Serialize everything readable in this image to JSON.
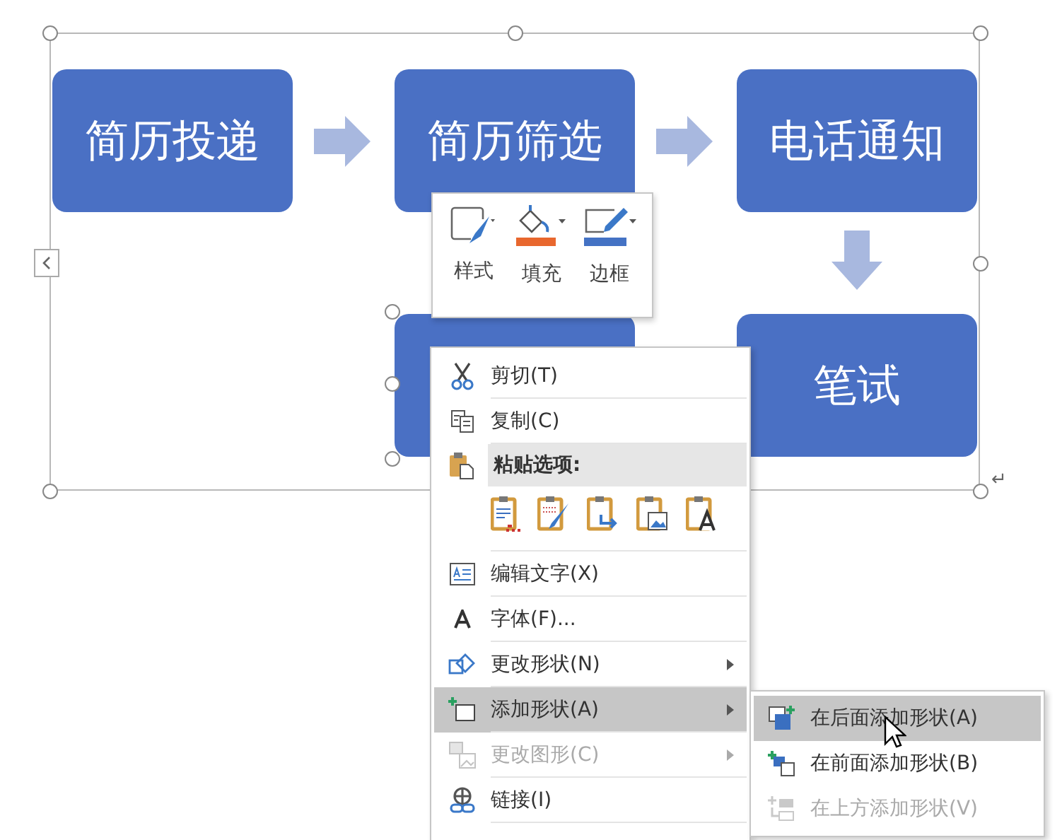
{
  "diagram": {
    "shapes": [
      {
        "text": "简历投递",
        "selected": false
      },
      {
        "text": "简历筛选",
        "selected": false
      },
      {
        "text": "电话通知",
        "selected": false
      },
      {
        "selected": true
      },
      {
        "text": "笔试",
        "selected": false
      }
    ],
    "paragraph_mark": "↵"
  },
  "mini_toolbar": {
    "buttons": [
      {
        "label": "样式"
      },
      {
        "label": "填充"
      },
      {
        "label": "边框"
      }
    ]
  },
  "context_menu": {
    "items": [
      {
        "kind": "command",
        "label": "剪切(T)",
        "disabled": false,
        "selected": false,
        "submenu": false
      },
      {
        "kind": "command",
        "label": "复制(C)",
        "disabled": false,
        "selected": false,
        "submenu": false
      },
      {
        "kind": "header",
        "label": "粘贴选项:"
      },
      {
        "kind": "paste_options"
      },
      {
        "kind": "command",
        "label": "编辑文字(X)",
        "disabled": false,
        "selected": false,
        "submenu": false
      },
      {
        "kind": "command",
        "label": "字体(F)...",
        "disabled": false,
        "selected": false,
        "submenu": false
      },
      {
        "kind": "command",
        "label": "更改形状(N)",
        "disabled": false,
        "selected": false,
        "submenu": true
      },
      {
        "kind": "command",
        "label": "添加形状(A)",
        "disabled": false,
        "selected": true,
        "submenu": true
      },
      {
        "kind": "command",
        "label": "更改图形(C)",
        "disabled": true,
        "selected": false,
        "submenu": true
      },
      {
        "kind": "command",
        "label": "链接(I)",
        "disabled": false,
        "selected": false,
        "submenu": false
      }
    ]
  },
  "submenu": {
    "items": [
      {
        "label": "在后面添加形状(A)",
        "disabled": false,
        "selected": true
      },
      {
        "label": "在前面添加形状(B)",
        "disabled": false,
        "selected": false
      },
      {
        "label": "在上方添加形状(V)",
        "disabled": true,
        "selected": false
      }
    ]
  }
}
